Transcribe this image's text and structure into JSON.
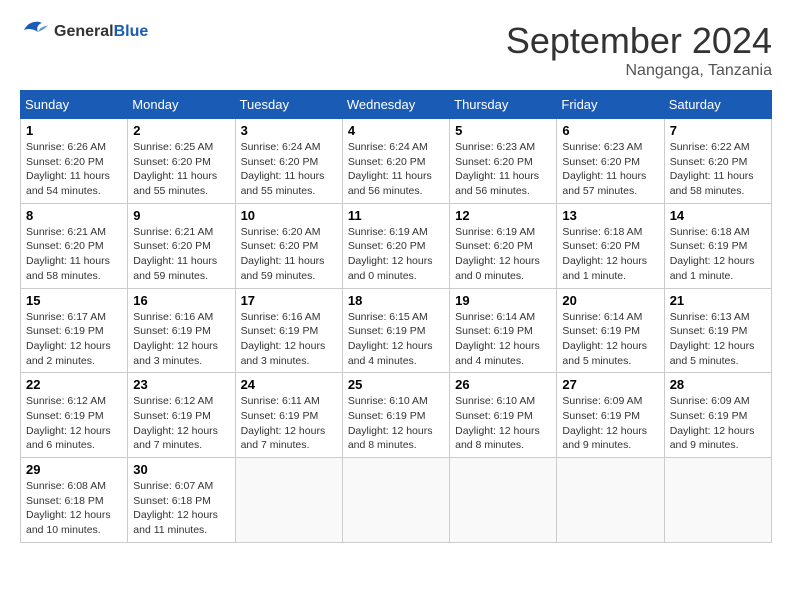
{
  "logo": {
    "line1": "General",
    "line2": "Blue"
  },
  "title": "September 2024",
  "location": "Nanganga, Tanzania",
  "weekdays": [
    "Sunday",
    "Monday",
    "Tuesday",
    "Wednesday",
    "Thursday",
    "Friday",
    "Saturday"
  ],
  "weeks": [
    [
      {
        "day": "1",
        "info": "Sunrise: 6:26 AM\nSunset: 6:20 PM\nDaylight: 11 hours\nand 54 minutes."
      },
      {
        "day": "2",
        "info": "Sunrise: 6:25 AM\nSunset: 6:20 PM\nDaylight: 11 hours\nand 55 minutes."
      },
      {
        "day": "3",
        "info": "Sunrise: 6:24 AM\nSunset: 6:20 PM\nDaylight: 11 hours\nand 55 minutes."
      },
      {
        "day": "4",
        "info": "Sunrise: 6:24 AM\nSunset: 6:20 PM\nDaylight: 11 hours\nand 56 minutes."
      },
      {
        "day": "5",
        "info": "Sunrise: 6:23 AM\nSunset: 6:20 PM\nDaylight: 11 hours\nand 56 minutes."
      },
      {
        "day": "6",
        "info": "Sunrise: 6:23 AM\nSunset: 6:20 PM\nDaylight: 11 hours\nand 57 minutes."
      },
      {
        "day": "7",
        "info": "Sunrise: 6:22 AM\nSunset: 6:20 PM\nDaylight: 11 hours\nand 58 minutes."
      }
    ],
    [
      {
        "day": "8",
        "info": "Sunrise: 6:21 AM\nSunset: 6:20 PM\nDaylight: 11 hours\nand 58 minutes."
      },
      {
        "day": "9",
        "info": "Sunrise: 6:21 AM\nSunset: 6:20 PM\nDaylight: 11 hours\nand 59 minutes."
      },
      {
        "day": "10",
        "info": "Sunrise: 6:20 AM\nSunset: 6:20 PM\nDaylight: 11 hours\nand 59 minutes."
      },
      {
        "day": "11",
        "info": "Sunrise: 6:19 AM\nSunset: 6:20 PM\nDaylight: 12 hours\nand 0 minutes."
      },
      {
        "day": "12",
        "info": "Sunrise: 6:19 AM\nSunset: 6:20 PM\nDaylight: 12 hours\nand 0 minutes."
      },
      {
        "day": "13",
        "info": "Sunrise: 6:18 AM\nSunset: 6:20 PM\nDaylight: 12 hours\nand 1 minute."
      },
      {
        "day": "14",
        "info": "Sunrise: 6:18 AM\nSunset: 6:19 PM\nDaylight: 12 hours\nand 1 minute."
      }
    ],
    [
      {
        "day": "15",
        "info": "Sunrise: 6:17 AM\nSunset: 6:19 PM\nDaylight: 12 hours\nand 2 minutes."
      },
      {
        "day": "16",
        "info": "Sunrise: 6:16 AM\nSunset: 6:19 PM\nDaylight: 12 hours\nand 3 minutes."
      },
      {
        "day": "17",
        "info": "Sunrise: 6:16 AM\nSunset: 6:19 PM\nDaylight: 12 hours\nand 3 minutes."
      },
      {
        "day": "18",
        "info": "Sunrise: 6:15 AM\nSunset: 6:19 PM\nDaylight: 12 hours\nand 4 minutes."
      },
      {
        "day": "19",
        "info": "Sunrise: 6:14 AM\nSunset: 6:19 PM\nDaylight: 12 hours\nand 4 minutes."
      },
      {
        "day": "20",
        "info": "Sunrise: 6:14 AM\nSunset: 6:19 PM\nDaylight: 12 hours\nand 5 minutes."
      },
      {
        "day": "21",
        "info": "Sunrise: 6:13 AM\nSunset: 6:19 PM\nDaylight: 12 hours\nand 5 minutes."
      }
    ],
    [
      {
        "day": "22",
        "info": "Sunrise: 6:12 AM\nSunset: 6:19 PM\nDaylight: 12 hours\nand 6 minutes."
      },
      {
        "day": "23",
        "info": "Sunrise: 6:12 AM\nSunset: 6:19 PM\nDaylight: 12 hours\nand 7 minutes."
      },
      {
        "day": "24",
        "info": "Sunrise: 6:11 AM\nSunset: 6:19 PM\nDaylight: 12 hours\nand 7 minutes."
      },
      {
        "day": "25",
        "info": "Sunrise: 6:10 AM\nSunset: 6:19 PM\nDaylight: 12 hours\nand 8 minutes."
      },
      {
        "day": "26",
        "info": "Sunrise: 6:10 AM\nSunset: 6:19 PM\nDaylight: 12 hours\nand 8 minutes."
      },
      {
        "day": "27",
        "info": "Sunrise: 6:09 AM\nSunset: 6:19 PM\nDaylight: 12 hours\nand 9 minutes."
      },
      {
        "day": "28",
        "info": "Sunrise: 6:09 AM\nSunset: 6:19 PM\nDaylight: 12 hours\nand 9 minutes."
      }
    ],
    [
      {
        "day": "29",
        "info": "Sunrise: 6:08 AM\nSunset: 6:18 PM\nDaylight: 12 hours\nand 10 minutes."
      },
      {
        "day": "30",
        "info": "Sunrise: 6:07 AM\nSunset: 6:18 PM\nDaylight: 12 hours\nand 11 minutes."
      },
      {
        "day": "",
        "info": ""
      },
      {
        "day": "",
        "info": ""
      },
      {
        "day": "",
        "info": ""
      },
      {
        "day": "",
        "info": ""
      },
      {
        "day": "",
        "info": ""
      }
    ]
  ]
}
